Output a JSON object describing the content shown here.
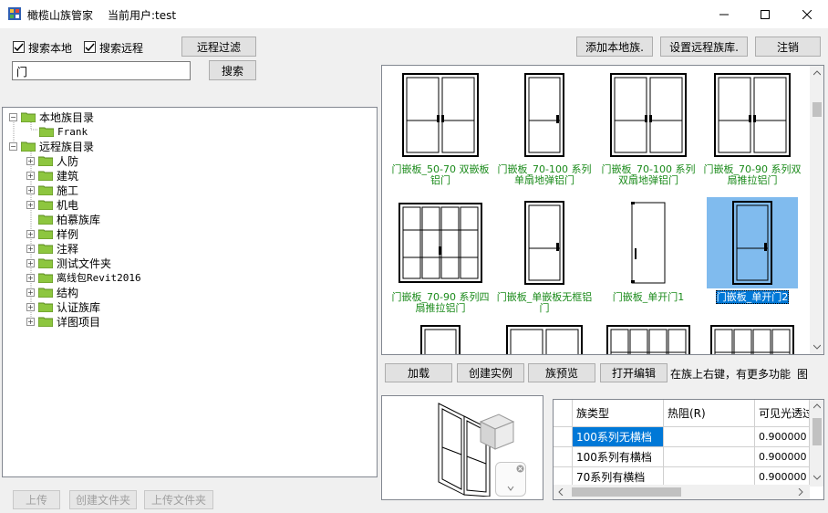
{
  "window": {
    "app_title": "橄榄山族管家",
    "current_user": "当前用户:test"
  },
  "toolbar": {
    "search_local_label": "搜索本地",
    "search_remote_label": "搜索远程",
    "remote_filter_label": "远程过滤",
    "search_value": "门",
    "search_button_label": "搜索",
    "add_local_family_label": "添加本地族.",
    "set_remote_library_label": "设置远程族库.",
    "logout_label": "注销"
  },
  "tree": {
    "local_root": "本地族目录",
    "local_children": [
      "Frank"
    ],
    "remote_root": "远程族目录",
    "remote_children": [
      "人防",
      "建筑",
      "施工",
      "机电",
      "柏慕族库",
      "样例",
      "注释",
      "测试文件夹",
      "离线包Revit2016",
      "结构",
      "认证族库",
      "详图项目"
    ]
  },
  "gallery": {
    "items": [
      {
        "caption": "门嵌板_50-70 双嵌板铝门",
        "icon": "double-door-icon"
      },
      {
        "caption": "门嵌板_70-100 系列单扇地弹铝门",
        "icon": "single-door-icon"
      },
      {
        "caption": "门嵌板_70-100 系列双扇地弹铝门",
        "icon": "double-door-icon"
      },
      {
        "caption": "门嵌板_70-90 系列双扇推拉铝门",
        "icon": "double-door-icon"
      },
      {
        "caption": "门嵌板_70-90 系列四扇推拉铝门",
        "icon": "four-panel-door-icon"
      },
      {
        "caption": "门嵌板_单嵌板无框铝门",
        "icon": "single-door-icon"
      },
      {
        "caption": "门嵌板_单开门1",
        "icon": "glass-door-icon"
      },
      {
        "caption": "门嵌板_单开门2",
        "icon": "single-door-icon",
        "selected": true
      }
    ]
  },
  "actions": {
    "load_label": "加载",
    "create_instance_label": "创建实例",
    "preview_label": "族预览",
    "open_edit_label": "打开编辑",
    "hint_text": "在族上右键，有更多功能",
    "trailing_text": "图"
  },
  "type_grid": {
    "columns": [
      "族类型",
      "热阻(R)",
      "可见光透过"
    ],
    "rows": [
      {
        "type": "100系列无横档",
        "r": "",
        "vis": "0.900000"
      },
      {
        "type": "100系列有横档",
        "r": "",
        "vis": "0.900000"
      },
      {
        "type": "70系列有横档",
        "r": "",
        "vis": "0.900000"
      }
    ]
  },
  "bottom": {
    "upload_label": "上传",
    "create_folder_label": "创建文件夹",
    "upload_folder_label": "上传文件夹"
  }
}
